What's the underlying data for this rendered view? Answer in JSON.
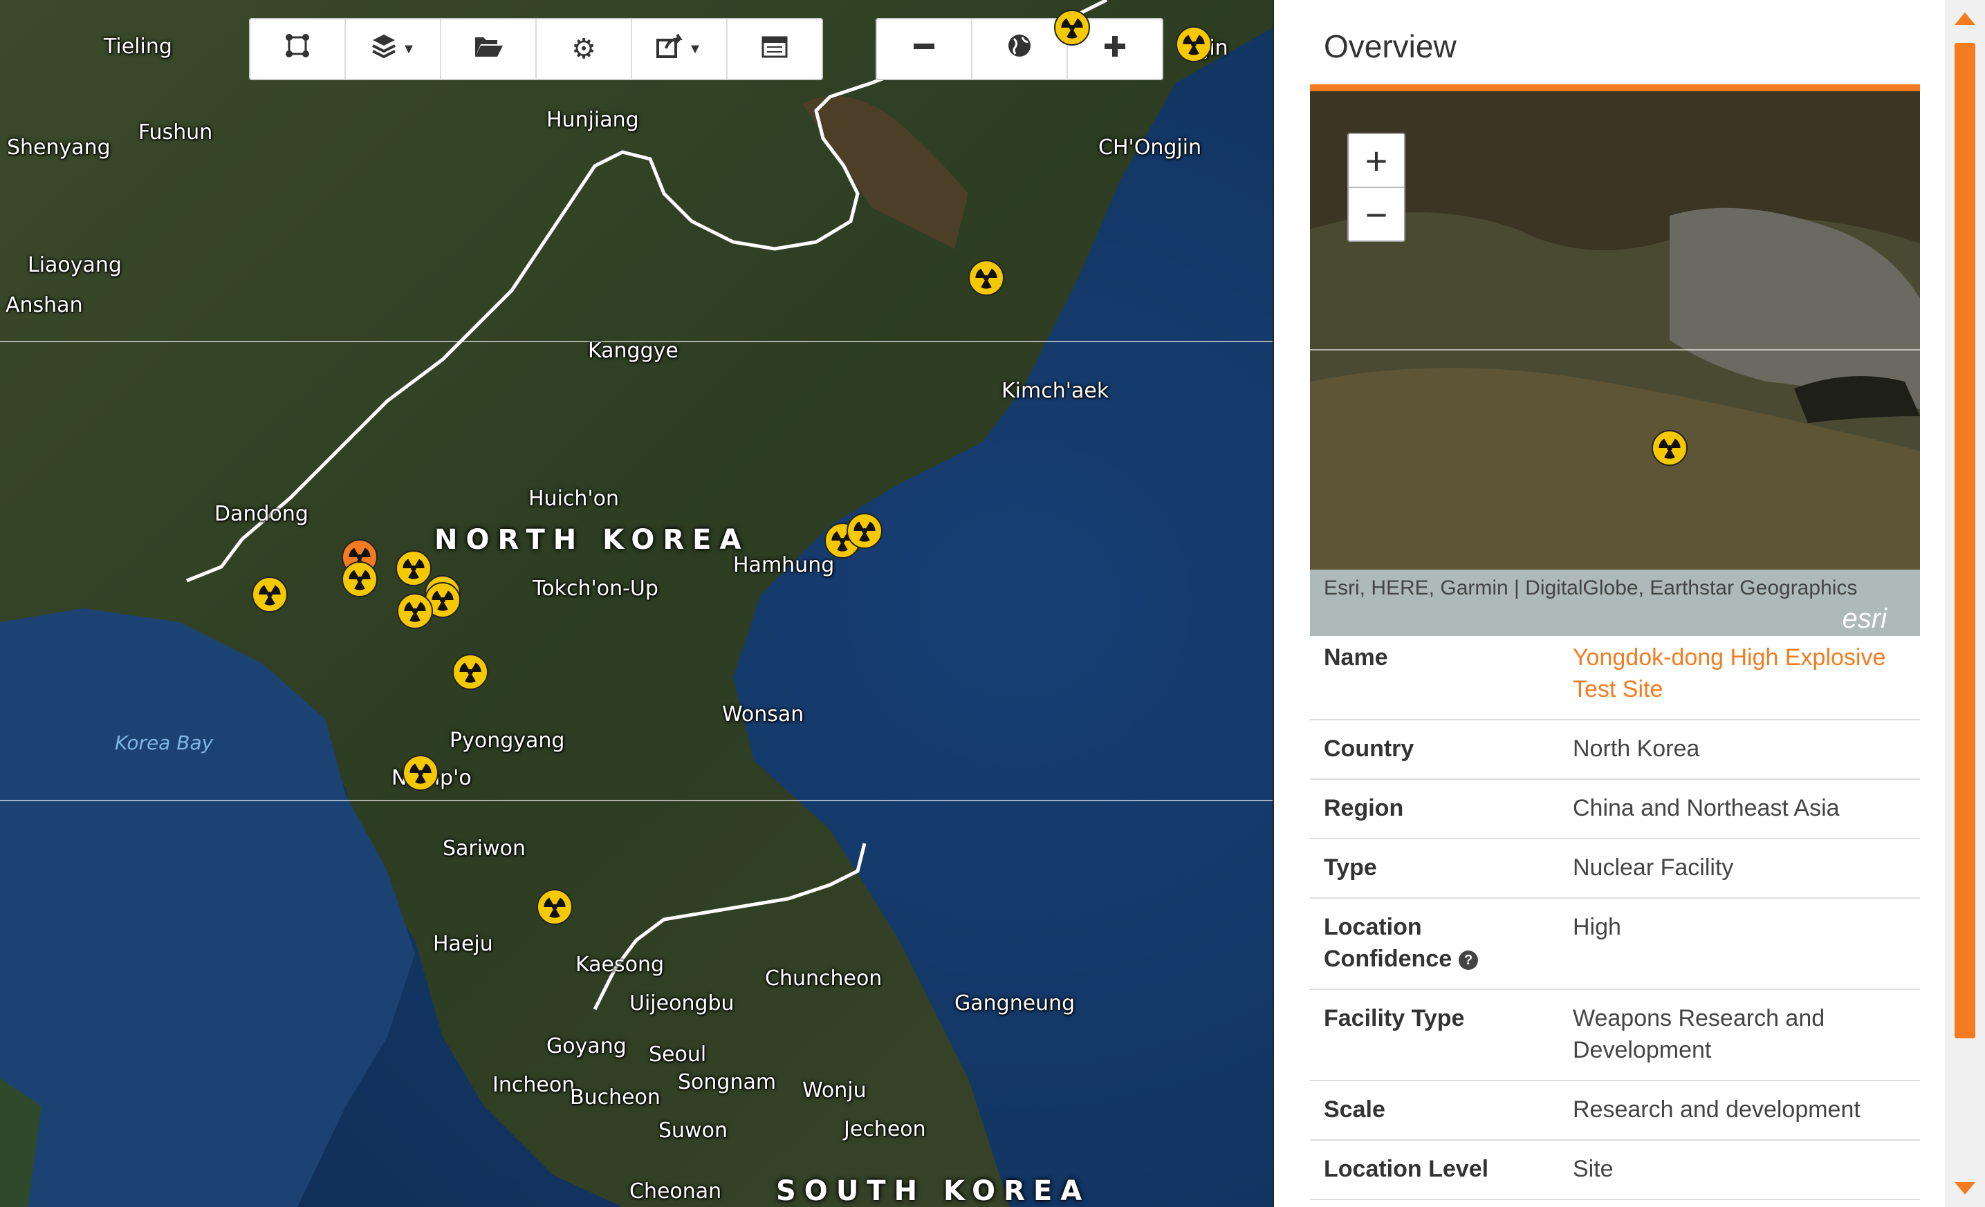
{
  "toolbar": {
    "tools": [
      "draw-icon",
      "layers-icon",
      "folder-icon",
      "gear-icon",
      "share-icon",
      "calendar-icon"
    ],
    "zoom": [
      "minus-icon",
      "globe-icon",
      "plus-icon"
    ]
  },
  "map": {
    "cities": [
      "Tieling",
      "Shenyang",
      "Fushun",
      "Hunjiang",
      "CH'Ongjin",
      "Liaoyang",
      "Anshan",
      "Kanggye",
      "Kimch'aek",
      "Huich'on",
      "Dandong",
      "Tokch'on-Up",
      "Hamhung",
      "Wonsan",
      "Pyongyang",
      "Namp'o",
      "Sariwon",
      "Haeju",
      "Kaesong",
      "Chuncheon",
      "Uijeongbu",
      "Gangneung",
      "Goyang",
      "Seoul",
      "Incheon",
      "Bucheon",
      "Songnam",
      "Wonju",
      "Suwon",
      "Jecheon",
      "Cheonan",
      "jin"
    ],
    "countries": [
      "NORTH KOREA",
      "SOUTH KOREA"
    ],
    "water": [
      "Korea Bay"
    ],
    "marker_icon": "nuclear-radiation-icon",
    "colors": {
      "marker": "#f5c800",
      "marker_selected": "#f47b20",
      "border": "#ffffff"
    }
  },
  "panel": {
    "title": "Overview",
    "attribution": "Esri, HERE, Garmin | DigitalGlobe, Earthstar Geographics",
    "logo": "esri",
    "zoom_in": "+",
    "zoom_out": "−",
    "accent": "#f47b20",
    "rows": [
      {
        "key": "Name",
        "value": "Yongdok-dong High Explosive Test Site"
      },
      {
        "key": "Country",
        "value": "North Korea"
      },
      {
        "key": "Region",
        "value": "China and Northeast Asia"
      },
      {
        "key": "Type",
        "value": "Nuclear Facility"
      },
      {
        "key": "Location Confidence",
        "value": "High"
      },
      {
        "key": "Facility Type",
        "value": "Weapons Research and Development"
      },
      {
        "key": "Scale",
        "value": "Research and development"
      },
      {
        "key": "Location Level",
        "value": "Site"
      }
    ]
  }
}
